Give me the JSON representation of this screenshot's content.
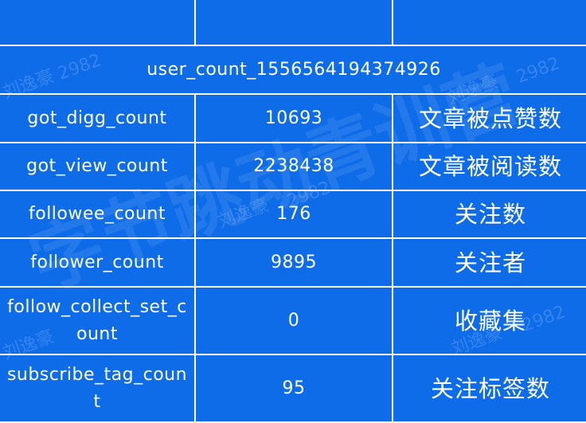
{
  "header_row": {
    "cells": [
      "",
      "",
      ""
    ]
  },
  "user_count": "user_count_1556564194374926",
  "rows": [
    {
      "field": "got_digg_count",
      "value": "10693",
      "meaning": "文章被点赞数"
    },
    {
      "field": "got_view_count",
      "value": "2238438",
      "meaning": "文章被阅读数"
    },
    {
      "field": "followee_count",
      "value": "176",
      "meaning": "关注数"
    },
    {
      "field": "follower_count",
      "value": "9895",
      "meaning": "关注者"
    },
    {
      "field": "follow_collect_set_count",
      "value": "0",
      "meaning": "收藏集"
    },
    {
      "field": "subscribe_tag_count",
      "value": "95",
      "meaning": "关注标签数"
    }
  ],
  "watermark": {
    "name": "刘逸豪",
    "number": "2982",
    "big": "字节跳动青训营"
  }
}
